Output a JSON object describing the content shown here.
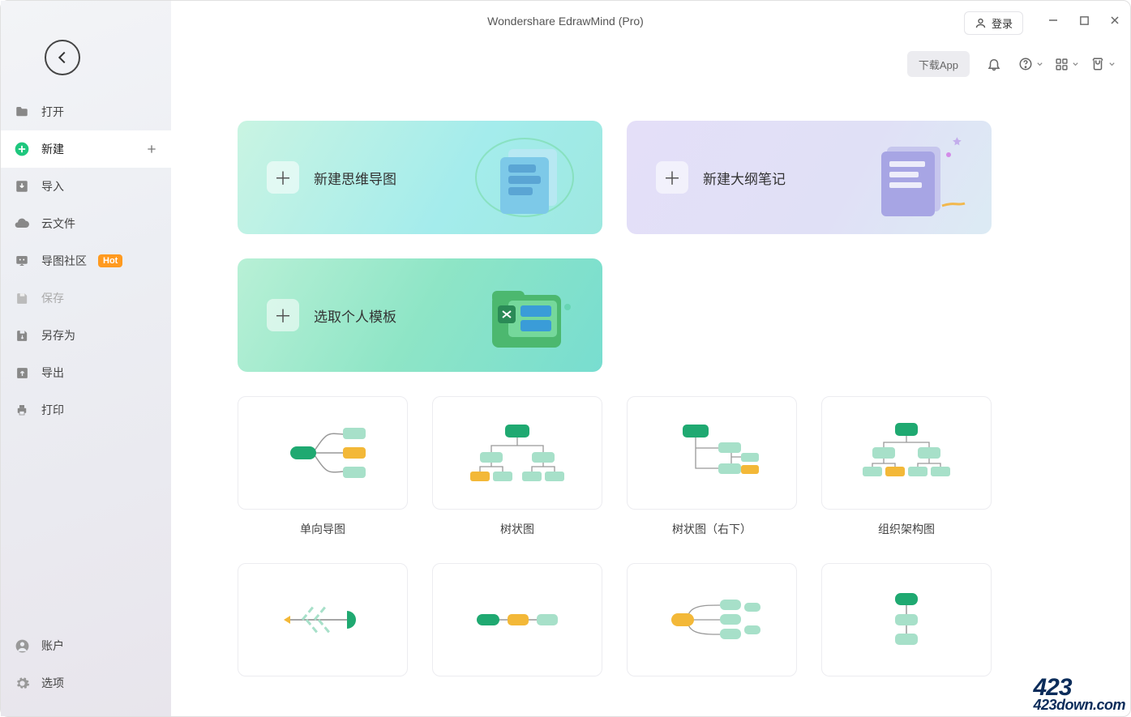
{
  "title": "Wondershare EdrawMind (Pro)",
  "login": "登录",
  "toolbar": {
    "download": "下载App"
  },
  "sidebar": {
    "items": [
      {
        "label": "打开",
        "icon": "folder"
      },
      {
        "label": "新建",
        "icon": "plus-circle",
        "active": true,
        "trailing_plus": true
      },
      {
        "label": "导入",
        "icon": "import"
      },
      {
        "label": "云文件",
        "icon": "cloud"
      },
      {
        "label": "导图社区",
        "icon": "community",
        "badge": "Hot"
      },
      {
        "label": "保存",
        "icon": "save",
        "disabled": true
      },
      {
        "label": "另存为",
        "icon": "save-as"
      },
      {
        "label": "导出",
        "icon": "export"
      },
      {
        "label": "打印",
        "icon": "print"
      }
    ],
    "bottom": [
      {
        "label": "账户",
        "icon": "user"
      },
      {
        "label": "选项",
        "icon": "gear"
      }
    ]
  },
  "hero": [
    {
      "label": "新建思维导图",
      "variant": "green"
    },
    {
      "label": "新建大纲笔记",
      "variant": "purple"
    },
    {
      "label": "选取个人模板",
      "variant": "green2"
    }
  ],
  "templates": [
    {
      "label": "单向导图",
      "kind": "radial"
    },
    {
      "label": "树状图",
      "kind": "tree"
    },
    {
      "label": "树状图（右下）",
      "kind": "tree-rd"
    },
    {
      "label": "组织架构图",
      "kind": "org"
    },
    {
      "label": "",
      "kind": "fishbone",
      "partial": true
    },
    {
      "label": "",
      "kind": "timeline",
      "partial": true
    },
    {
      "label": "",
      "kind": "bubble",
      "partial": true
    },
    {
      "label": "",
      "kind": "vertical",
      "partial": true
    }
  ],
  "watermark": {
    "big": "423",
    "small": "423down.com"
  }
}
